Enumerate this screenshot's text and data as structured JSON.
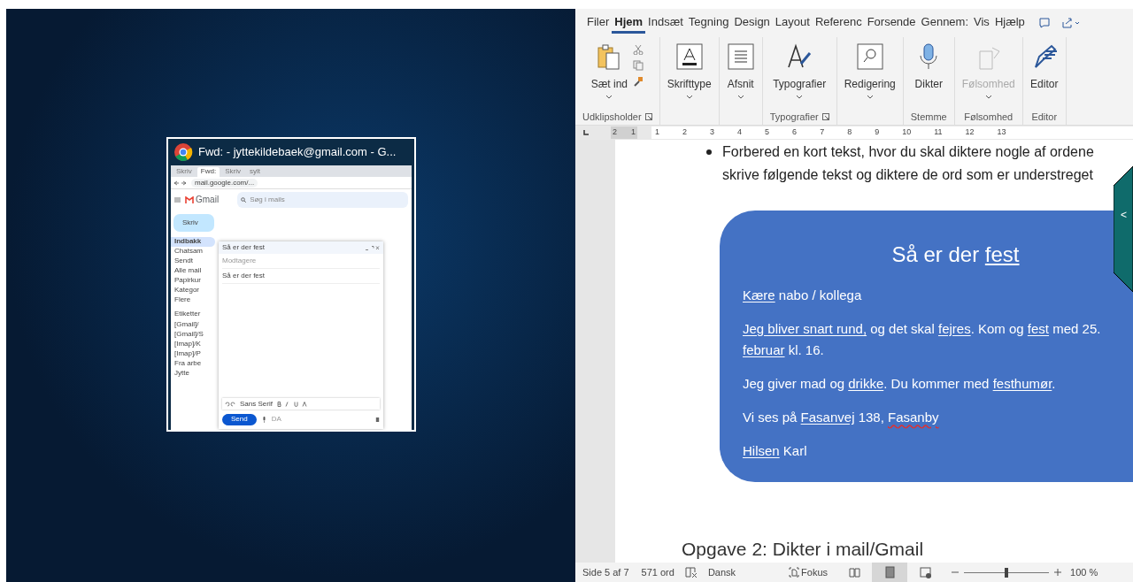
{
  "thumbnail_window": {
    "title": "Fwd: - jyttekildebaek@gmail.com - G...",
    "browser_tabs": [
      {
        "label": "Skriv",
        "selected": false
      },
      {
        "label": "Fwd:",
        "selected": true
      },
      {
        "label": "Skriv",
        "selected": false
      },
      {
        "label": "sylt",
        "selected": false
      }
    ],
    "address": "mail.google.com/...",
    "gmail": {
      "logo": "Gmail",
      "search_placeholder": "Søg i mails",
      "compose_button": "Skriv",
      "nav": [
        {
          "label": "Indbakk",
          "selected": true
        },
        {
          "label": "Chatsam",
          "selected": false
        },
        {
          "label": "Sendt",
          "selected": false
        },
        {
          "label": "Alle mail",
          "selected": false
        },
        {
          "label": "Papirkur",
          "selected": false
        },
        {
          "label": "Kategor",
          "selected": false
        },
        {
          "label": "Flere",
          "selected": false
        }
      ],
      "labels_heading": "Etiketter",
      "labels": [
        "[Gmail]/",
        "[Gmail]/S",
        "[Imap]/K",
        "[Imap]/P",
        "Fra arbe",
        "Jytte"
      ],
      "compose": {
        "title": "Så er der fest",
        "recipients_placeholder": "Modtagere",
        "subject": "Så er der fest",
        "font": "Sans Serif",
        "send": "Send",
        "language": "DA"
      }
    }
  },
  "word": {
    "tabs": [
      {
        "label": "Filer",
        "selected": false
      },
      {
        "label": "Hjem",
        "selected": true
      },
      {
        "label": "Indsæt",
        "selected": false
      },
      {
        "label": "Tegning",
        "selected": false
      },
      {
        "label": "Design",
        "selected": false
      },
      {
        "label": "Layout",
        "selected": false
      },
      {
        "label": "Referenc",
        "selected": false
      },
      {
        "label": "Forsende",
        "selected": false
      },
      {
        "label": "Gennem:",
        "selected": false
      },
      {
        "label": "Vis",
        "selected": false
      },
      {
        "label": "Hjælp",
        "selected": false
      }
    ],
    "groups": [
      {
        "label": "Udklipsholder",
        "launcher": true,
        "buttons": [
          {
            "kind": "paste",
            "label": "Sæt ind",
            "caret": true,
            "disabled": false
          }
        ]
      },
      {
        "buttons": [
          {
            "kind": "font",
            "label": "Skrifttype",
            "caret": true,
            "disabled": false
          }
        ]
      },
      {
        "buttons": [
          {
            "kind": "paragraph",
            "label": "Afsnit",
            "caret": true,
            "disabled": false
          }
        ]
      },
      {
        "label": "Typografier",
        "launcher": true,
        "buttons": [
          {
            "kind": "styles",
            "label": "Typografier",
            "caret": true,
            "disabled": false
          }
        ]
      },
      {
        "buttons": [
          {
            "kind": "find",
            "label": "Redigering",
            "caret": true,
            "disabled": false
          }
        ]
      },
      {
        "label": "Stemme",
        "launcher": false,
        "buttons": [
          {
            "kind": "dictate",
            "label": "Dikter",
            "caret": false,
            "disabled": false
          }
        ]
      },
      {
        "label": "Følsomhed",
        "launcher": false,
        "buttons": [
          {
            "kind": "sensitivity",
            "label": "Følsomhed",
            "caret": true,
            "disabled": true
          }
        ]
      },
      {
        "label": "Editor",
        "launcher": false,
        "buttons": [
          {
            "kind": "editor",
            "label": "Editor",
            "caret": false,
            "disabled": false
          }
        ]
      }
    ],
    "ruler": {
      "left_numbers": [
        "2",
        "1"
      ],
      "numbers": [
        "1",
        "2",
        "3",
        "4",
        "5",
        "6",
        "7",
        "8",
        "9",
        "10",
        "11",
        "12",
        "13"
      ]
    },
    "document": {
      "bullet": "Forbered en kort tekst, hvor du skal diktere nogle af ordene",
      "text": "skrive følgende tekst og diktere de ord som er understreget",
      "card": {
        "title": [
          {
            "text": "Så er der ",
            "kind": "plain"
          },
          {
            "text": "fest",
            "kind": "underline"
          }
        ],
        "paragraphs": [
          [
            {
              "text": "Kære",
              "kind": "underline"
            },
            {
              "text": " nabo / kollega",
              "kind": "plain"
            }
          ],
          [
            {
              "text": "Jeg bliver snart rund,",
              "kind": "underline"
            },
            {
              "text": " og det skal ",
              "kind": "plain"
            },
            {
              "text": "fejres",
              "kind": "underline"
            },
            {
              "text": ". Kom og ",
              "kind": "plain"
            },
            {
              "text": "fest",
              "kind": "underline"
            },
            {
              "text": " med 25. ",
              "kind": "plain"
            },
            {
              "text": "februar",
              "kind": "underline"
            },
            {
              "text": " kl. 16.",
              "kind": "plain"
            }
          ],
          [
            {
              "text": "Jeg giver mad og ",
              "kind": "plain"
            },
            {
              "text": "drikke",
              "kind": "underline"
            },
            {
              "text": ". Du kommer med ",
              "kind": "plain"
            },
            {
              "text": "festhumør",
              "kind": "underline"
            },
            {
              "text": ".",
              "kind": "plain"
            }
          ],
          [
            {
              "text": "Vi ses på ",
              "kind": "plain"
            },
            {
              "text": "Fasanvej",
              "kind": "underline"
            },
            {
              "text": " 138, ",
              "kind": "plain"
            },
            {
              "text": "Fasanby",
              "kind": "spelling"
            }
          ],
          [
            {
              "text": "Hilsen",
              "kind": "underline"
            },
            {
              "text": " Karl",
              "kind": "plain"
            }
          ]
        ]
      },
      "heading": "Opgave 2: Dikter i mail/Gmail"
    },
    "side_tab": "<",
    "status": {
      "page": "Side 5 af 7",
      "words": "571 ord",
      "language": "Dansk",
      "focus": "Fokus",
      "views": [
        {
          "kind": "read",
          "selected": false
        },
        {
          "kind": "print",
          "selected": true
        },
        {
          "kind": "web",
          "selected": false
        }
      ],
      "zoom": {
        "level": 0.5,
        "reading": "100 %"
      }
    }
  }
}
